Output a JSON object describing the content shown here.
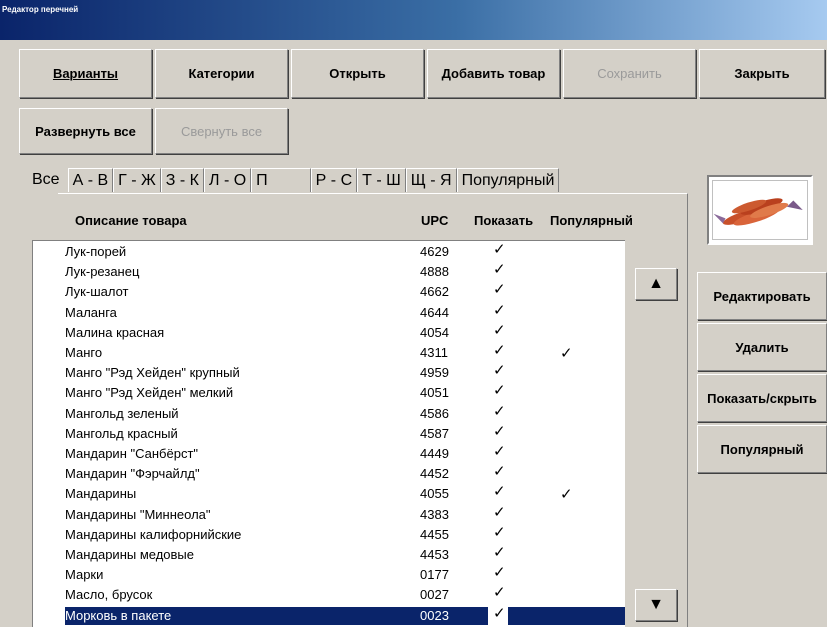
{
  "window": {
    "title": "Редактор перечней"
  },
  "toolbar": {
    "variants": "Варианты",
    "categories": "Категории",
    "open": "Открыть",
    "add_item": "Добавить товар",
    "save": "Сохранить",
    "close": "Закрыть",
    "expand_all": "Развернуть все",
    "collapse_all": "Свернуть все"
  },
  "tabs": [
    "Все",
    "А - В",
    "Г - Ж",
    "З - К",
    "Л - О",
    "П",
    "Р - С",
    "Т - Ш",
    "Щ - Я",
    "Популярный"
  ],
  "columns": {
    "desc": "Описание товара",
    "upc": "UPC",
    "show": "Показать",
    "popular": "Популярный"
  },
  "rows": [
    {
      "desc": "Лук-порей",
      "upc": "4629",
      "show": "✓",
      "popular": ""
    },
    {
      "desc": "Лук-резанец",
      "upc": "4888",
      "show": "✓",
      "popular": ""
    },
    {
      "desc": "Лук-шалот",
      "upc": "4662",
      "show": "✓",
      "popular": ""
    },
    {
      "desc": "Маланга",
      "upc": "4644",
      "show": "✓",
      "popular": ""
    },
    {
      "desc": "Малина красная",
      "upc": "4054",
      "show": "✓",
      "popular": ""
    },
    {
      "desc": "Манго",
      "upc": "4311",
      "show": "✓",
      "popular": "✓"
    },
    {
      "desc": "Манго \"Рэд Хейден\" крупный",
      "upc": "4959",
      "show": "✓",
      "popular": ""
    },
    {
      "desc": "Манго \"Рэд Хейден\" мелкий",
      "upc": "4051",
      "show": "✓",
      "popular": ""
    },
    {
      "desc": "Мангольд зеленый",
      "upc": "4586",
      "show": "✓",
      "popular": ""
    },
    {
      "desc": "Мангольд красный",
      "upc": "4587",
      "show": "✓",
      "popular": ""
    },
    {
      "desc": "Мандарин \"Санбёрст\"",
      "upc": "4449",
      "show": "✓",
      "popular": ""
    },
    {
      "desc": "Мандарин \"Фэрчайлд\"",
      "upc": "4452",
      "show": "✓",
      "popular": ""
    },
    {
      "desc": "Мандарины",
      "upc": "4055",
      "show": "✓",
      "popular": "✓"
    },
    {
      "desc": "Мандарины \"Миннеола\"",
      "upc": "4383",
      "show": "✓",
      "popular": ""
    },
    {
      "desc": "Мандарины калифорнийские",
      "upc": "4455",
      "show": "✓",
      "popular": ""
    },
    {
      "desc": "Мандарины медовые",
      "upc": "4453",
      "show": "✓",
      "popular": ""
    },
    {
      "desc": "Марки",
      "upc": "0177",
      "show": "✓",
      "popular": ""
    },
    {
      "desc": "Масло, брусок",
      "upc": "0027",
      "show": "✓",
      "popular": ""
    },
    {
      "desc": "Морковь в пакете",
      "upc": "0023",
      "show": "✓",
      "popular": "",
      "selected": true
    }
  ],
  "scroll": {
    "up": "▲",
    "down": "▼"
  },
  "side": {
    "edit": "Редактировать",
    "delete": "Удалить",
    "show_hide": "Показать/скрыть",
    "popular": "Популярный"
  },
  "icons": {
    "up": "triangle-up-icon",
    "down": "triangle-down-icon",
    "thumb": "carrot-image"
  }
}
